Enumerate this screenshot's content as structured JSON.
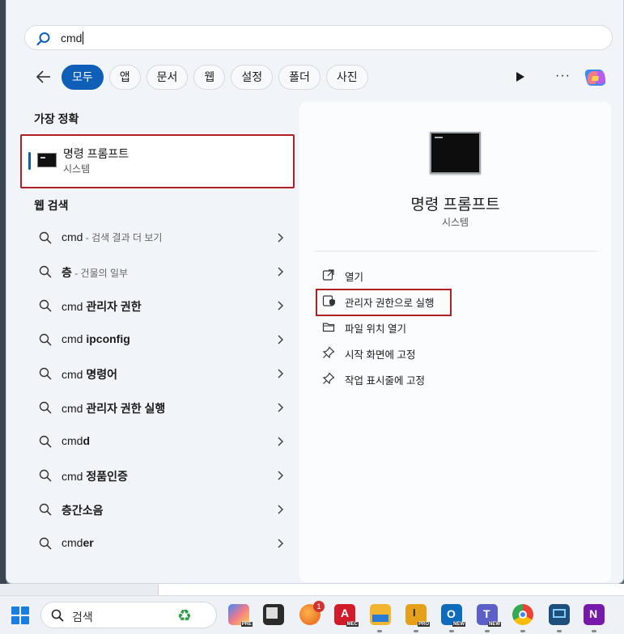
{
  "search": {
    "query": "cmd"
  },
  "filters": [
    "모두",
    "앱",
    "문서",
    "웹",
    "설정",
    "폴더",
    "사진"
  ],
  "best_match": {
    "title": "가장 정확",
    "app_name": "명령 프롬프트",
    "app_type": "시스템"
  },
  "web_search": {
    "title": "웹 검색",
    "results": [
      {
        "prefix": "cmd",
        "bold": "",
        "hint": " - 검색 결과 더 보기"
      },
      {
        "prefix": "",
        "bold": "층",
        "hint": " - 건물의 일부"
      },
      {
        "prefix": "cmd ",
        "bold": "관리자 권한",
        "hint": ""
      },
      {
        "prefix": "cmd ",
        "bold": "ipconfig",
        "hint": ""
      },
      {
        "prefix": "cmd ",
        "bold": "명령어",
        "hint": ""
      },
      {
        "prefix": "cmd ",
        "bold": "관리자 권한 실행",
        "hint": ""
      },
      {
        "prefix": "cmd",
        "bold": "d",
        "hint": ""
      },
      {
        "prefix": "cmd ",
        "bold": "정품인증",
        "hint": ""
      },
      {
        "prefix": "",
        "bold": "층간소음",
        "hint": ""
      },
      {
        "prefix": "cmd",
        "bold": "er",
        "hint": ""
      }
    ]
  },
  "detail": {
    "app_name": "명령 프롬프트",
    "app_type": "시스템",
    "actions": [
      {
        "label": "열기",
        "icon": "open-icon"
      },
      {
        "label": "관리자 권한으로 실행",
        "icon": "shield-icon"
      },
      {
        "label": "파일 위치 열기",
        "icon": "folder-icon"
      },
      {
        "label": "시작 화면에 고정",
        "icon": "pin-icon"
      },
      {
        "label": "작업 표시줄에 고정",
        "icon": "pin-icon"
      }
    ]
  },
  "taskbar": {
    "search_placeholder": "검색",
    "notification_count": "1",
    "icon_labels": [
      "PRE",
      "MEC",
      "PRO",
      "NEW",
      "NEW"
    ]
  },
  "colors": {
    "accent": "#0f5fb8",
    "highlight": "#b01f24"
  }
}
